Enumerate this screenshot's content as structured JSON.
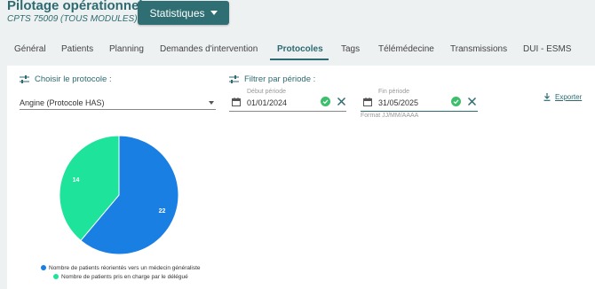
{
  "header": {
    "title": "Pilotage opérationnel",
    "subtitle": "CPTS 75009 (TOUS MODULES)",
    "stats_button": "Statistiques"
  },
  "tabs": [
    {
      "label": "Général"
    },
    {
      "label": "Patients"
    },
    {
      "label": "Planning"
    },
    {
      "label": "Demandes d'intervention"
    },
    {
      "label": "Protocoles",
      "active": true
    },
    {
      "label": "Tags"
    },
    {
      "label": "Télémédecine"
    },
    {
      "label": "Transmissions"
    },
    {
      "label": "DUI - ESMS"
    }
  ],
  "filters": {
    "protocol_label": "Choisir le protocole :",
    "protocol_value": "Angine (Protocole HAS)",
    "period_label": "Filtrer par période :",
    "start": {
      "label": "Début période",
      "value": "01/01/2024"
    },
    "end": {
      "label": "Fin période",
      "value": "31/05/2025"
    },
    "format_hint": "Format JJ/MM/AAAA"
  },
  "export_label": "Exporter",
  "colors": {
    "accent": "#2d6b70",
    "series_blue": "#1a7fe3",
    "series_green": "#1ee39a",
    "valid": "#3cbf6a"
  },
  "chart_data": {
    "type": "pie",
    "series": [
      {
        "name": "Nombre de patients réorientés vers un médecin généraliste",
        "value": 22,
        "color": "#1a7fe3"
      },
      {
        "name": "Nombre de patients pris en charge par le délégué",
        "value": 14,
        "color": "#1ee39a"
      }
    ],
    "legend_position": "bottom"
  }
}
